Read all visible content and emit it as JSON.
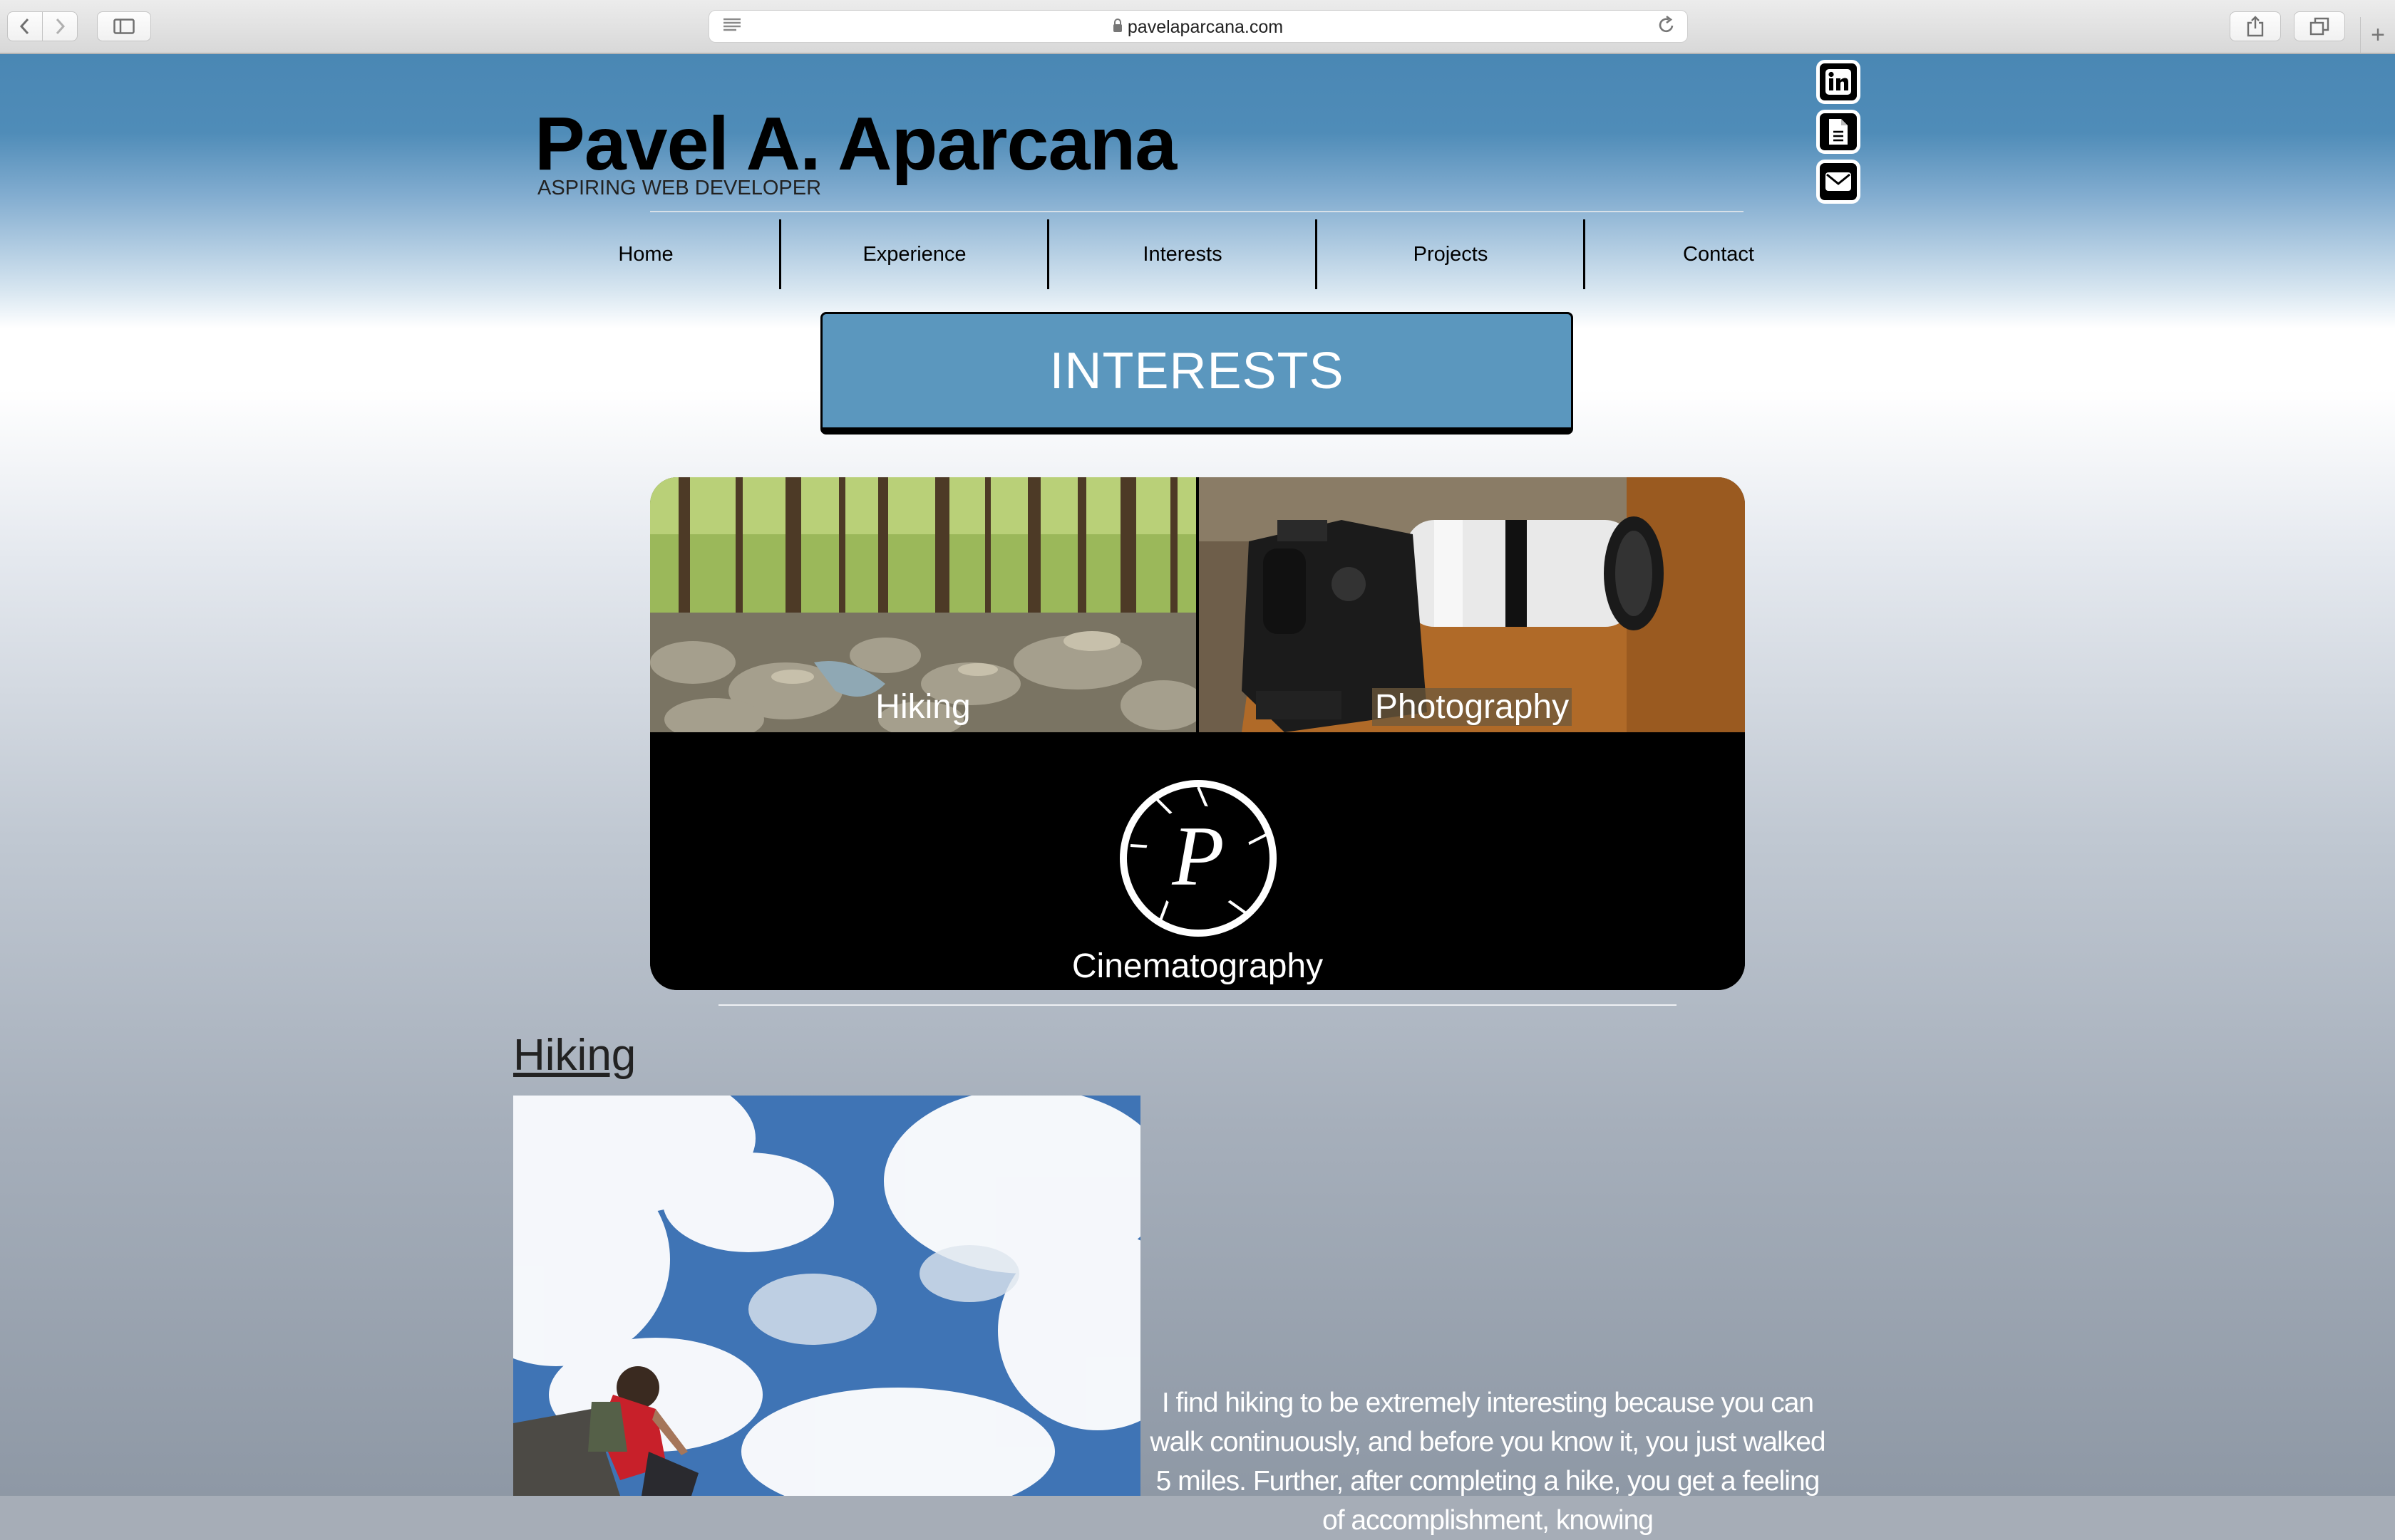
{
  "browser": {
    "url": "pavelaparcana.com",
    "back_icon": "chevron-left-icon",
    "forward_icon": "chevron-right-icon",
    "sidebar_icon": "sidebar-icon",
    "reader_icon": "reader-icon",
    "reload_icon": "reload-icon",
    "share_icon": "share-icon",
    "tabs_icon": "tabs-icon",
    "new_tab_icon": "plus-icon"
  },
  "header": {
    "title": "Pavel A. Aparcana",
    "subtitle": "ASPIRING WEB DEVELOPER",
    "social": [
      "linkedin-icon",
      "document-icon",
      "envelope-icon"
    ]
  },
  "nav": {
    "items": [
      "Home",
      "Experience",
      "Interests",
      "Projects",
      "Contact"
    ]
  },
  "banner": {
    "title": "INTERESTS"
  },
  "tiles": {
    "hiking": "Hiking",
    "photography": "Photography",
    "cinematography": "Cinematography",
    "logo_letter": "P"
  },
  "hiking_section": {
    "title": "Hiking",
    "text": "I find hiking to be extremely interesting because you can walk continuously, and before you know it, you just walked 5 miles. Further, after completing a hike, you get a feeling of accomplishment, knowing"
  },
  "colors": {
    "header_blue": "#4a87b4",
    "banner_blue": "#5b97be"
  }
}
